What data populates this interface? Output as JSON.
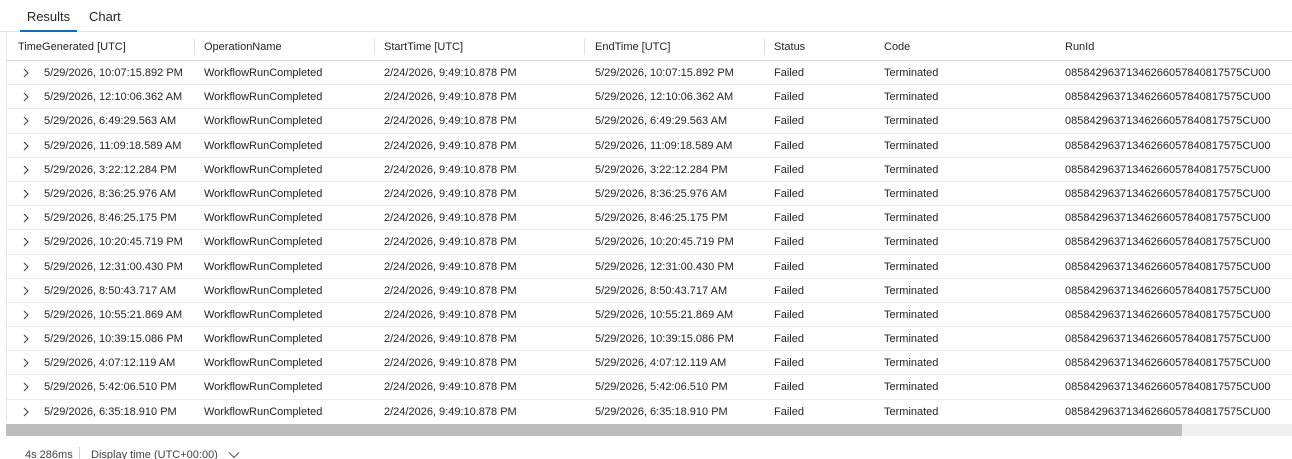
{
  "tabs": [
    {
      "label": "Results",
      "active": true
    },
    {
      "label": "Chart",
      "active": false
    }
  ],
  "columns": [
    "TimeGenerated [UTC]",
    "OperationName",
    "StartTime [UTC]",
    "EndTime [UTC]",
    "Status",
    "Code",
    "RunId"
  ],
  "rows": [
    [
      "5/29/2026, 10:07:15.892 PM",
      "WorkflowRunCompleted",
      "2/24/2026, 9:49:10.878 PM",
      "5/29/2026, 10:07:15.892 PM",
      "Failed",
      "Terminated",
      "08584296371346266057840817575CU00"
    ],
    [
      "5/29/2026, 12:10:06.362 AM",
      "WorkflowRunCompleted",
      "2/24/2026, 9:49:10.878 PM",
      "5/29/2026, 12:10:06.362 AM",
      "Failed",
      "Terminated",
      "08584296371346266057840817575CU00"
    ],
    [
      "5/29/2026, 6:49:29.563 AM",
      "WorkflowRunCompleted",
      "2/24/2026, 9:49:10.878 PM",
      "5/29/2026, 6:49:29.563 AM",
      "Failed",
      "Terminated",
      "08584296371346266057840817575CU00"
    ],
    [
      "5/29/2026, 11:09:18.589 AM",
      "WorkflowRunCompleted",
      "2/24/2026, 9:49:10.878 PM",
      "5/29/2026, 11:09:18.589 AM",
      "Failed",
      "Terminated",
      "08584296371346266057840817575CU00"
    ],
    [
      "5/29/2026, 3:22:12.284 PM",
      "WorkflowRunCompleted",
      "2/24/2026, 9:49:10.878 PM",
      "5/29/2026, 3:22:12.284 PM",
      "Failed",
      "Terminated",
      "08584296371346266057840817575CU00"
    ],
    [
      "5/29/2026, 8:36:25.976 AM",
      "WorkflowRunCompleted",
      "2/24/2026, 9:49:10.878 PM",
      "5/29/2026, 8:36:25.976 AM",
      "Failed",
      "Terminated",
      "08584296371346266057840817575CU00"
    ],
    [
      "5/29/2026, 8:46:25.175 PM",
      "WorkflowRunCompleted",
      "2/24/2026, 9:49:10.878 PM",
      "5/29/2026, 8:46:25.175 PM",
      "Failed",
      "Terminated",
      "08584296371346266057840817575CU00"
    ],
    [
      "5/29/2026, 10:20:45.719 PM",
      "WorkflowRunCompleted",
      "2/24/2026, 9:49:10.878 PM",
      "5/29/2026, 10:20:45.719 PM",
      "Failed",
      "Terminated",
      "08584296371346266057840817575CU00"
    ],
    [
      "5/29/2026, 12:31:00.430 PM",
      "WorkflowRunCompleted",
      "2/24/2026, 9:49:10.878 PM",
      "5/29/2026, 12:31:00.430 PM",
      "Failed",
      "Terminated",
      "08584296371346266057840817575CU00"
    ],
    [
      "5/29/2026, 8:50:43.717 AM",
      "WorkflowRunCompleted",
      "2/24/2026, 9:49:10.878 PM",
      "5/29/2026, 8:50:43.717 AM",
      "Failed",
      "Terminated",
      "08584296371346266057840817575CU00"
    ],
    [
      "5/29/2026, 10:55:21.869 AM",
      "WorkflowRunCompleted",
      "2/24/2026, 9:49:10.878 PM",
      "5/29/2026, 10:55:21.869 AM",
      "Failed",
      "Terminated",
      "08584296371346266057840817575CU00"
    ],
    [
      "5/29/2026, 10:39:15.086 PM",
      "WorkflowRunCompleted",
      "2/24/2026, 9:49:10.878 PM",
      "5/29/2026, 10:39:15.086 PM",
      "Failed",
      "Terminated",
      "08584296371346266057840817575CU00"
    ],
    [
      "5/29/2026, 4:07:12.119 AM",
      "WorkflowRunCompleted",
      "2/24/2026, 9:49:10.878 PM",
      "5/29/2026, 4:07:12.119 AM",
      "Failed",
      "Terminated",
      "08584296371346266057840817575CU00"
    ],
    [
      "5/29/2026, 5:42:06.510 PM",
      "WorkflowRunCompleted",
      "2/24/2026, 9:49:10.878 PM",
      "5/29/2026, 5:42:06.510 PM",
      "Failed",
      "Terminated",
      "08584296371346266057840817575CU00"
    ],
    [
      "5/29/2026, 6:35:18.910 PM",
      "WorkflowRunCompleted",
      "2/24/2026, 9:49:10.878 PM",
      "5/29/2026, 6:35:18.910 PM",
      "Failed",
      "Terminated",
      "08584296371346266057840817575CU00"
    ]
  ],
  "status_bar": {
    "duration": "4s 286ms",
    "display_time": "Display time (UTC+00:00)"
  },
  "icons": {
    "row_expand": "chevron-right-icon",
    "display_time_dropdown": "chevron-down-icon"
  },
  "colors": {
    "accent": "#0f6cbd"
  }
}
